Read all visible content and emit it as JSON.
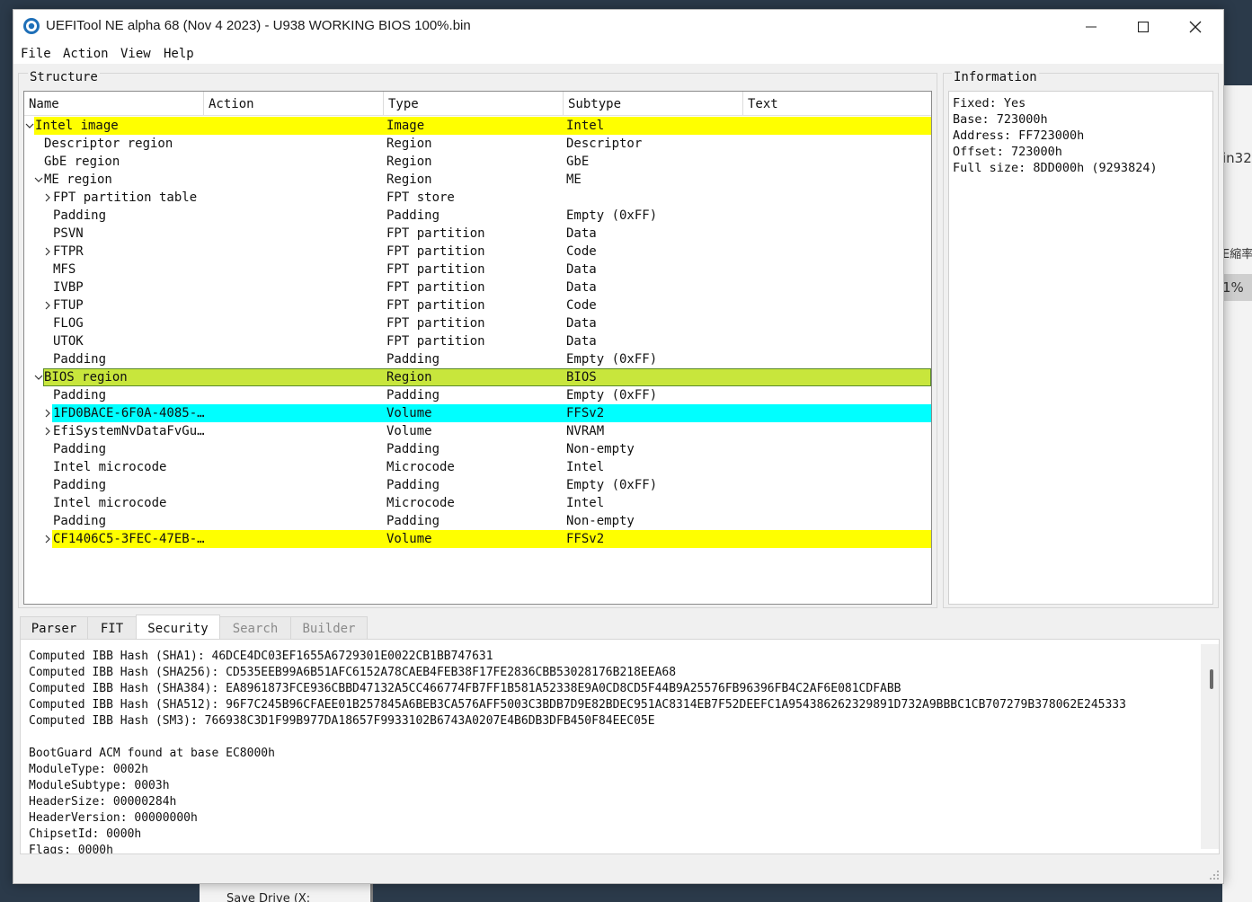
{
  "window": {
    "title": "UEFITool NE alpha 68 (Nov  4 2023) - U938 WORKING BIOS 100%.bin",
    "minimize_icon": "minimize-icon",
    "maximize_icon": "maximize-icon",
    "close_icon": "close-icon"
  },
  "menu": [
    "File",
    "Action",
    "View",
    "Help"
  ],
  "structure": {
    "label": "Structure",
    "columns": [
      "Name",
      "Action",
      "Type",
      "Subtype",
      "Text"
    ],
    "rows": [
      {
        "name": "Intel image",
        "type": "Image",
        "subtype": "Intel",
        "level": 0,
        "arrow": "down",
        "hl": "yellow"
      },
      {
        "name": "Descriptor region",
        "type": "Region",
        "subtype": "Descriptor",
        "level": 1,
        "arrow": "",
        "hl": ""
      },
      {
        "name": "GbE region",
        "type": "Region",
        "subtype": "GbE",
        "level": 1,
        "arrow": "",
        "hl": ""
      },
      {
        "name": "ME region",
        "type": "Region",
        "subtype": "ME",
        "level": 1,
        "arrow": "down",
        "hl": ""
      },
      {
        "name": "FPT partition table",
        "type": "FPT store",
        "subtype": "",
        "level": 2,
        "arrow": "right",
        "hl": ""
      },
      {
        "name": "Padding",
        "type": "Padding",
        "subtype": "Empty (0xFF)",
        "level": 2,
        "arrow": "",
        "hl": ""
      },
      {
        "name": "PSVN",
        "type": "FPT partition",
        "subtype": "Data",
        "level": 2,
        "arrow": "",
        "hl": ""
      },
      {
        "name": "FTPR",
        "type": "FPT partition",
        "subtype": "Code",
        "level": 2,
        "arrow": "right",
        "hl": ""
      },
      {
        "name": "MFS",
        "type": "FPT partition",
        "subtype": "Data",
        "level": 2,
        "arrow": "",
        "hl": ""
      },
      {
        "name": "IVBP",
        "type": "FPT partition",
        "subtype": "Data",
        "level": 2,
        "arrow": "",
        "hl": ""
      },
      {
        "name": "FTUP",
        "type": "FPT partition",
        "subtype": "Code",
        "level": 2,
        "arrow": "right",
        "hl": ""
      },
      {
        "name": "FLOG",
        "type": "FPT partition",
        "subtype": "Data",
        "level": 2,
        "arrow": "",
        "hl": ""
      },
      {
        "name": "UTOK",
        "type": "FPT partition",
        "subtype": "Data",
        "level": 2,
        "arrow": "",
        "hl": ""
      },
      {
        "name": "Padding",
        "type": "Padding",
        "subtype": "Empty (0xFF)",
        "level": 2,
        "arrow": "",
        "hl": ""
      },
      {
        "name": "BIOS region",
        "type": "Region",
        "subtype": "BIOS",
        "level": 1,
        "arrow": "down",
        "hl": "sel"
      },
      {
        "name": "Padding",
        "type": "Padding",
        "subtype": "Empty (0xFF)",
        "level": 2,
        "arrow": "",
        "hl": ""
      },
      {
        "name": "1FD0BACE-6F0A-4085-…",
        "type": "Volume",
        "subtype": "FFSv2",
        "level": 2,
        "arrow": "right",
        "hl": "cyan"
      },
      {
        "name": "EfiSystemNvDataFvGu…",
        "type": "Volume",
        "subtype": "NVRAM",
        "level": 2,
        "arrow": "right",
        "hl": ""
      },
      {
        "name": "Padding",
        "type": "Padding",
        "subtype": "Non-empty",
        "level": 2,
        "arrow": "",
        "hl": ""
      },
      {
        "name": "Intel microcode",
        "type": "Microcode",
        "subtype": "Intel",
        "level": 2,
        "arrow": "",
        "hl": ""
      },
      {
        "name": "Padding",
        "type": "Padding",
        "subtype": "Empty (0xFF)",
        "level": 2,
        "arrow": "",
        "hl": ""
      },
      {
        "name": "Intel microcode",
        "type": "Microcode",
        "subtype": "Intel",
        "level": 2,
        "arrow": "",
        "hl": ""
      },
      {
        "name": "Padding",
        "type": "Padding",
        "subtype": "Non-empty",
        "level": 2,
        "arrow": "",
        "hl": ""
      },
      {
        "name": "CF1406C5-3FEC-47EB-…",
        "type": "Volume",
        "subtype": "FFSv2",
        "level": 2,
        "arrow": "right",
        "hl": "yellow"
      }
    ]
  },
  "information": {
    "label": "Information",
    "lines": [
      "Fixed: Yes",
      "Base: 723000h",
      "Address: FF723000h",
      "Offset: 723000h",
      "Full size: 8DD000h (9293824)"
    ]
  },
  "tabs": [
    {
      "label": "Parser",
      "state": "normal"
    },
    {
      "label": "FIT",
      "state": "normal"
    },
    {
      "label": "Security",
      "state": "active"
    },
    {
      "label": "Search",
      "state": "disabled"
    },
    {
      "label": "Builder",
      "state": "disabled"
    }
  ],
  "security_log": [
    "Computed IBB Hash (SHA1): 46DCE4DC03EF1655A6729301E0022CB1BB747631",
    "Computed IBB Hash (SHA256): CD535EEB99A6B51AFC6152A78CAEB4FEB38F17FE2836CBB53028176B218EEA68",
    "Computed IBB Hash (SHA384): EA8961873FCE936CBBD47132A5CC466774FB7FF1B581A52338E9A0CD8CD5F44B9A25576FB96396FB4C2AF6E081CDFABB",
    "Computed IBB Hash (SHA512): 96F7C245B96CFAEE01B257845A6BEB3CA576AFF5003C3BDB7D9E82BDEC951AC8314EB7F52DEEFC1A954386262329891D732A9BBBC1CB707279B378062E245333",
    "Computed IBB Hash (SM3): 766938C3D1F99B977DA18657F9933102B6743A0207E4B6DB3DFB450F84EEC05E",
    "",
    "BootGuard ACM found at base EC8000h",
    "ModuleType: 0002h",
    "ModuleSubtype: 0003h",
    "HeaderSize: 00000284h",
    "HeaderVersion: 00000000h",
    "ChipsetId: 0000h",
    "Flags: 0000h"
  ],
  "background": {
    "right_items": [
      "in32",
      "E縮率",
      "1%"
    ],
    "bottom_item": "Save Drive (X:"
  }
}
